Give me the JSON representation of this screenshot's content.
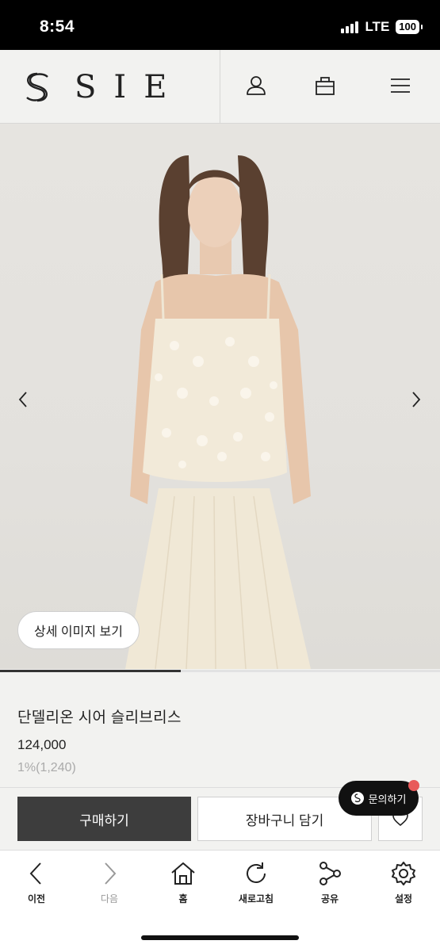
{
  "status_bar": {
    "time": "8:54",
    "network": "LTE",
    "battery": "100"
  },
  "header": {
    "brand": "SIE",
    "icons": [
      "user-icon",
      "bag-icon",
      "menu-icon"
    ]
  },
  "hero": {
    "detail_button": "상세 이미지 보기",
    "slide_progress": 0.41
  },
  "product": {
    "name": "단델리온 시어 슬리브리스",
    "price": "124,000",
    "points": "1%(1,240)"
  },
  "actions": {
    "buy": "구매하기",
    "cart": "장바구니 담기",
    "inquiry": "문의하기"
  },
  "bottom_nav": [
    {
      "label": "이전",
      "icon": "chevron-left-icon"
    },
    {
      "label": "다음",
      "icon": "chevron-right-icon"
    },
    {
      "label": "홈",
      "icon": "home-icon"
    },
    {
      "label": "새로고침",
      "icon": "refresh-icon"
    },
    {
      "label": "공유",
      "icon": "share-icon"
    },
    {
      "label": "설정",
      "icon": "gear-icon"
    }
  ],
  "colors": {
    "buy_button": "#3d3d3d",
    "inquiry_badge": "#111111",
    "notification_dot": "#e85a5a"
  }
}
